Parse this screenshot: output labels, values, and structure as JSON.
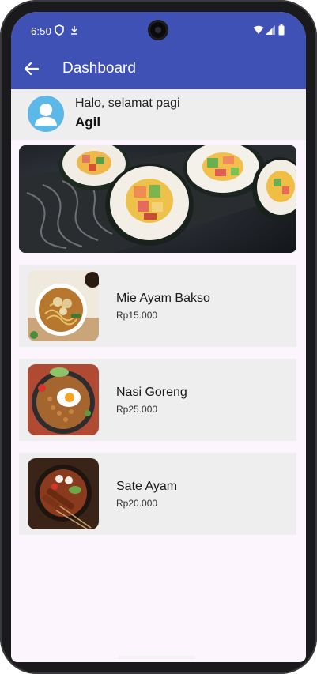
{
  "status_bar": {
    "time": "6:50",
    "icons": [
      "shield-icon",
      "download-icon",
      "wifi-icon",
      "signal-icon",
      "battery-icon"
    ]
  },
  "app_bar": {
    "title": "Dashboard",
    "back_icon": "arrow-left-icon",
    "color": "#3f51b5"
  },
  "greeting": {
    "text": "Halo, selamat pagi",
    "name": "Agil",
    "avatar_icon": "person-avatar-icon"
  },
  "banner": {
    "image": "sushi-rolls-banner"
  },
  "foods": [
    {
      "name": "Mie Ayam Bakso",
      "price": "Rp15.000",
      "image": "mie-ayam-bakso-photo"
    },
    {
      "name": "Nasi Goreng",
      "price": "Rp25.000",
      "image": "nasi-goreng-photo"
    },
    {
      "name": "Sate Ayam",
      "price": "Rp20.000",
      "image": "sate-ayam-photo"
    }
  ]
}
